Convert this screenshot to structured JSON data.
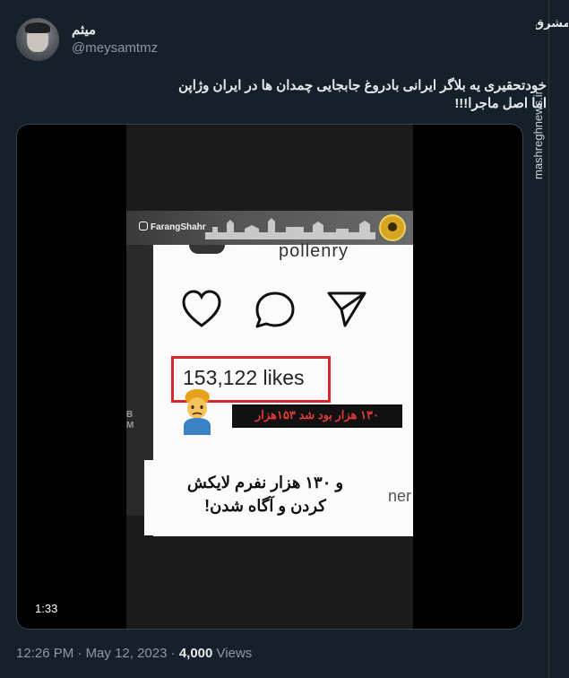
{
  "author": {
    "display_name": "میثم",
    "handle": "@meysamtmz"
  },
  "tweet": {
    "line1": "خودتحقیری یه بلاگر ایرانی بادروغ جابجایی چمدان ها در ایران وژاپن",
    "line2": "اما اصل ماجرا!!!"
  },
  "video": {
    "brand": "FarangShahr",
    "partial_top_text": "pollenry",
    "likes_text": "153,122 likes",
    "side_text_1": "B",
    "side_text_2": "M",
    "caption_red": "۱۳۰ هزار بود شد ۱۵۳هزار",
    "caption_white_line1": "و ۱۳۰ هزار نفرم لایکش",
    "caption_white_line2": "کردن و آگاه شدن!",
    "partial_right_text": "ner",
    "duration": "1:33"
  },
  "meta": {
    "time": "12:26 PM",
    "separator": "·",
    "date": "May 12, 2023",
    "views_count": "4,000",
    "views_label": "Views"
  },
  "watermark": {
    "logo_text": "مشرق",
    "url": "mashreghnews.ir"
  },
  "icons": [
    "heart-icon",
    "comment-icon",
    "share-icon",
    "instagram-icon",
    "person-emoji-icon"
  ],
  "colors": {
    "background": "#15202b",
    "text_primary": "#e7e9ea",
    "text_secondary": "#8b98a5",
    "highlight_red": "#d7262e",
    "badge_gold": "#d6a623"
  }
}
